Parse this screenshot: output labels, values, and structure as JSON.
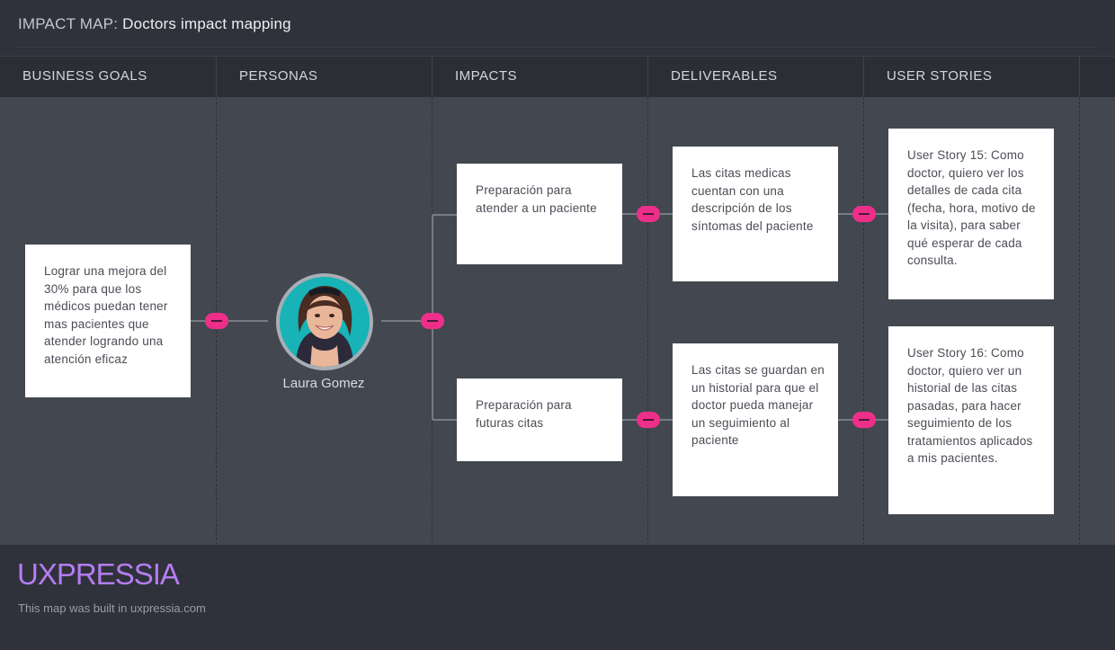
{
  "header": {
    "prefix": "IMPACT MAP:",
    "map_name": "Doctors impact mapping"
  },
  "columns": [
    "BUSINESS GOALS",
    "PERSONAS",
    "IMPACTS",
    "DELIVERABLES",
    "USER STORIES"
  ],
  "business_goal": "Lograr una mejora del 30% para que los médicos puedan tener mas pacientes que atender logrando una atención eficaz",
  "persona": {
    "name": "Laura Gomez"
  },
  "impacts": [
    "Preparación para atender a un paciente",
    "Preparación para futuras citas"
  ],
  "deliverables": [
    "Las citas medicas cuentan con una descripción de los síntomas del paciente",
    "Las citas se guardan en un historial para que el doctor pueda manejar un seguimiento al paciente"
  ],
  "user_stories": [
    "User Story 15: Como doctor, quiero ver los detalles de cada cita (fecha, hora, motivo de la visita), para saber qué esperar de cada consulta.",
    "User Story 16: Como doctor, quiero ver un historial de las citas pasadas, para hacer seguimiento de los tratamientos aplicados a mis pacientes."
  ],
  "footer": {
    "logo": "UXPRESSIA",
    "credit": "This map was built in uxpressia.com"
  },
  "colors": {
    "accent": "#ee2f8a",
    "logo": "#b57cf2",
    "board": "#434750",
    "card": "#ffffff"
  }
}
